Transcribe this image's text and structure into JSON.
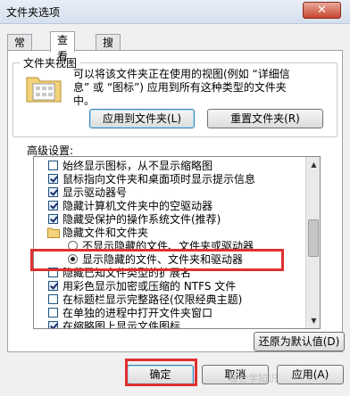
{
  "window": {
    "title": "文件夹选项",
    "close_glyph": "✕"
  },
  "tabs": [
    {
      "label": "常规"
    },
    {
      "label": "查看"
    },
    {
      "label": "搜索"
    }
  ],
  "folder_views": {
    "group_label": "文件夹视图",
    "description_lines": [
      "可以将该文件夹正在使用的视图(例如 “详细信",
      "息” 或 “图标”) 应用到所有这种类型的文件夹",
      "中。"
    ],
    "apply_button": "应用到文件夹(L)",
    "reset_button": "重置文件夹(R)"
  },
  "advanced": {
    "label": "高级设置:",
    "items": [
      {
        "type": "checkbox",
        "checked": false,
        "label": "始终显示图标，从不显示缩略图"
      },
      {
        "type": "checkbox",
        "checked": true,
        "label": "鼠标指向文件夹和桌面项时显示提示信息"
      },
      {
        "type": "checkbox",
        "checked": true,
        "label": "显示驱动器号"
      },
      {
        "type": "checkbox",
        "checked": true,
        "label": "隐藏计算机文件夹中的空驱动器"
      },
      {
        "type": "checkbox",
        "checked": true,
        "label": "隐藏受保护的操作系统文件(推荐)"
      },
      {
        "type": "folder",
        "checked": false,
        "label": "隐藏文件和文件夹"
      },
      {
        "type": "radio",
        "checked": false,
        "label": "不显示隐藏的文件、文件夹或驱动器"
      },
      {
        "type": "radio",
        "checked": true,
        "label": "显示隐藏的文件、文件夹和驱动器"
      },
      {
        "type": "checkbox",
        "checked": false,
        "label": "隐藏已知文件类型的扩展名"
      },
      {
        "type": "checkbox",
        "checked": true,
        "label": "用彩色显示加密或压缩的 NTFS 文件"
      },
      {
        "type": "checkbox",
        "checked": false,
        "label": "在标题栏显示完整路径(仅限经典主题)"
      },
      {
        "type": "checkbox",
        "checked": false,
        "label": "在单独的进程中打开文件夹窗口"
      },
      {
        "type": "checkbox",
        "checked": true,
        "label": "在缩略图上显示文件图标"
      }
    ],
    "restore_button": "还原为默认值(D)"
  },
  "footer": {
    "ok": "确定",
    "cancel": "取消",
    "apply": "应用(A)"
  },
  "watermark": "每分学知识",
  "colors": {
    "highlight": "#e03030",
    "titlebar": "#d5e0ee"
  }
}
